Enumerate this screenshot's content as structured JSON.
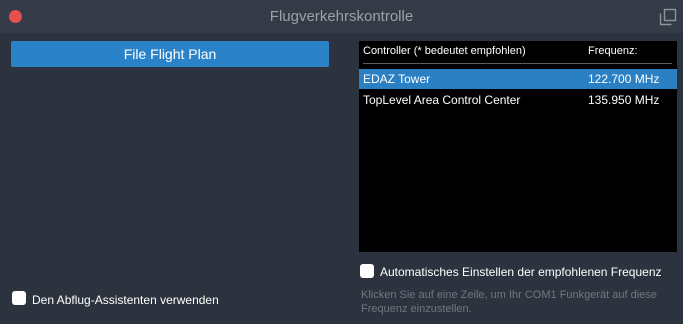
{
  "window": {
    "title": "Flugverkehrskontrolle"
  },
  "actions": {
    "file_flight_plan": "File Flight Plan"
  },
  "controller_table": {
    "headers": {
      "controller": "Controller (* bedeutet empfohlen)",
      "frequency": "Frequenz:"
    },
    "rows": [
      {
        "name": "EDAZ Tower",
        "frequency": "122.700 MHz",
        "selected": true
      },
      {
        "name": "TopLevel Area Control Center",
        "frequency": "135.950 MHz",
        "selected": false
      }
    ]
  },
  "options": {
    "auto_tune_label": "Automatisches Einstellen der empfohlenen Frequenz",
    "departure_assistant_label": "Den Abflug-Assistenten verwenden"
  },
  "help": {
    "line1": "Klicken Sie auf eine Zeile, um Ihr COM1 Funkgerät auf diese",
    "line2": "Frequenz einzustellen."
  },
  "colors": {
    "background": "#2c333e",
    "accent": "#2a83c9",
    "close": "#e4504b"
  },
  "icons": {
    "close": "close-icon",
    "popout": "popout-window-icon"
  }
}
